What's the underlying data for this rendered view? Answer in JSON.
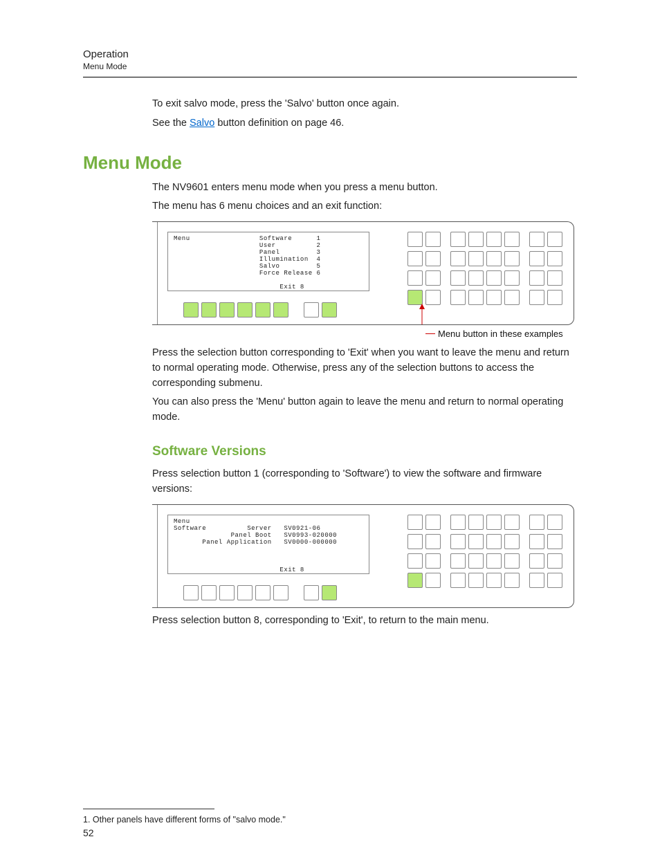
{
  "header": {
    "title": "Operation",
    "subtitle": "Menu Mode"
  },
  "intro": {
    "p1": "To exit salvo mode, press the 'Salvo' button once again.",
    "p2a": "See the ",
    "link": "Salvo",
    "p2b": " button definition on page 46."
  },
  "section1": {
    "heading": "Menu Mode",
    "p1": "The NV9601 enters menu mode when you press a menu button.",
    "p2": "The menu has 6 menu choices and an exit function:",
    "lcd_lines": "Menu                 Software      1\n                     User          2\n                     Panel         3\n                     Illumination  4\n                     Salvo         5\n                     Force Release 6\n\n                          Exit 8",
    "sel_buttons": [
      true,
      true,
      true,
      true,
      true,
      true,
      false,
      true
    ],
    "right_rows": 4,
    "menu_btn_row": 3,
    "menu_btn_col": 0,
    "callout": "Menu button in these examples",
    "p3": "Press the selection button corresponding to 'Exit' when you want to leave the menu and return to normal operating mode. Otherwise, press any of the selection buttons to access the corresponding submenu.",
    "p4": "You can also press the 'Menu' button again to leave the menu and return to normal operating mode."
  },
  "section2": {
    "heading": "Software Versions",
    "p1": "Press selection button 1 (corresponding to 'Software') to view the software and firmware versions:",
    "lcd_lines": "Menu\nSoftware          Server   SV0921-06\n              Panel Boot   SV0993-020000\n       Panel Application   SV0000-000000\n\n\n\n                          Exit 8",
    "sel_buttons": [
      false,
      false,
      false,
      false,
      false,
      false,
      false,
      true
    ],
    "right_rows": 4,
    "menu_btn_row": 3,
    "menu_btn_col": 0,
    "p2": "Press selection button 8, corresponding to 'Exit', to return to the main menu."
  },
  "footnote": "1.  Other panels have different forms of \"salvo mode.\"",
  "page_number": "52"
}
